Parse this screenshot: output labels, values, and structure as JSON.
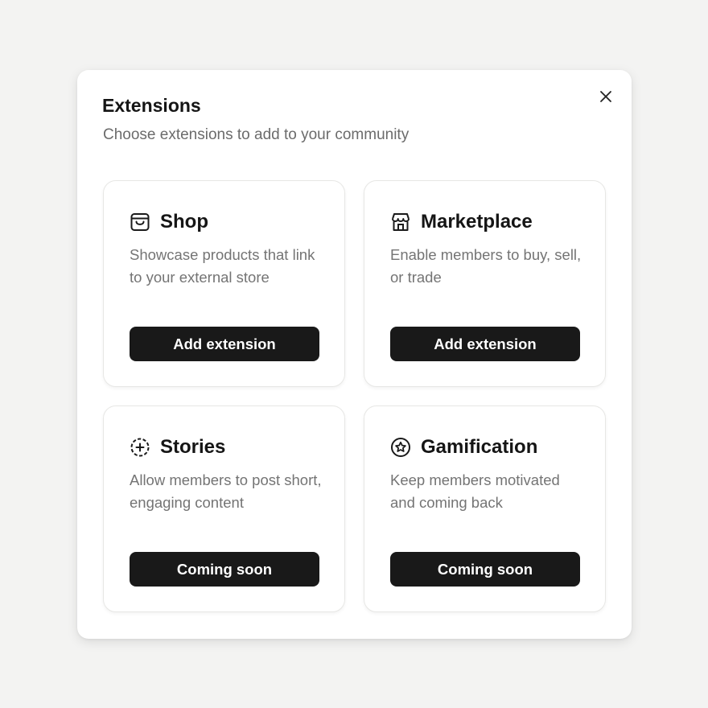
{
  "modal": {
    "title": "Extensions",
    "subtitle": "Choose extensions to add to your community",
    "close_icon": "close-icon"
  },
  "extensions": [
    {
      "title": "Shop",
      "description": "Showcase products that link to your external store",
      "button_label": "Add extension",
      "icon": "shopping-bag-icon"
    },
    {
      "title": "Marketplace",
      "description": "Enable members to buy, sell, or trade",
      "button_label": "Add extension",
      "icon": "storefront-icon"
    },
    {
      "title": "Stories",
      "description": "Allow members to post short, engaging content",
      "button_label": "Coming soon",
      "icon": "dashed-circle-plus-icon"
    },
    {
      "title": "Gamification",
      "description": "Keep members motivated and coming back",
      "button_label": "Coming soon",
      "icon": "star-badge-icon"
    }
  ],
  "colors": {
    "background": "#f3f3f2",
    "surface": "#ffffff",
    "button": "#191919",
    "text_primary": "#151515",
    "text_secondary": "#747474"
  }
}
